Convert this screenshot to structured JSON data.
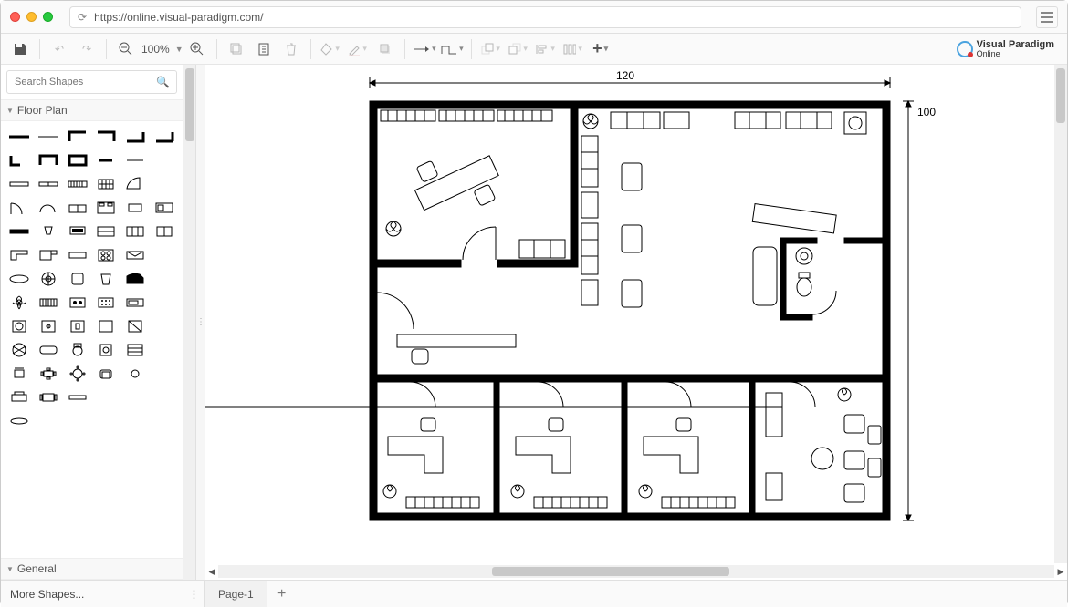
{
  "browser": {
    "url": "https://online.visual-paradigm.com/"
  },
  "toolbar": {
    "zoom_value": "100%"
  },
  "logo": {
    "line1": "Visual Paradigm",
    "line2": "Online"
  },
  "sidebar": {
    "search_placeholder": "Search Shapes",
    "category_floor": "Floor Plan",
    "category_general": "General",
    "more_shapes": "More Shapes..."
  },
  "pages": {
    "tab1": "Page-1"
  },
  "floorplan": {
    "top_dim": "120",
    "right_dim": "100"
  }
}
